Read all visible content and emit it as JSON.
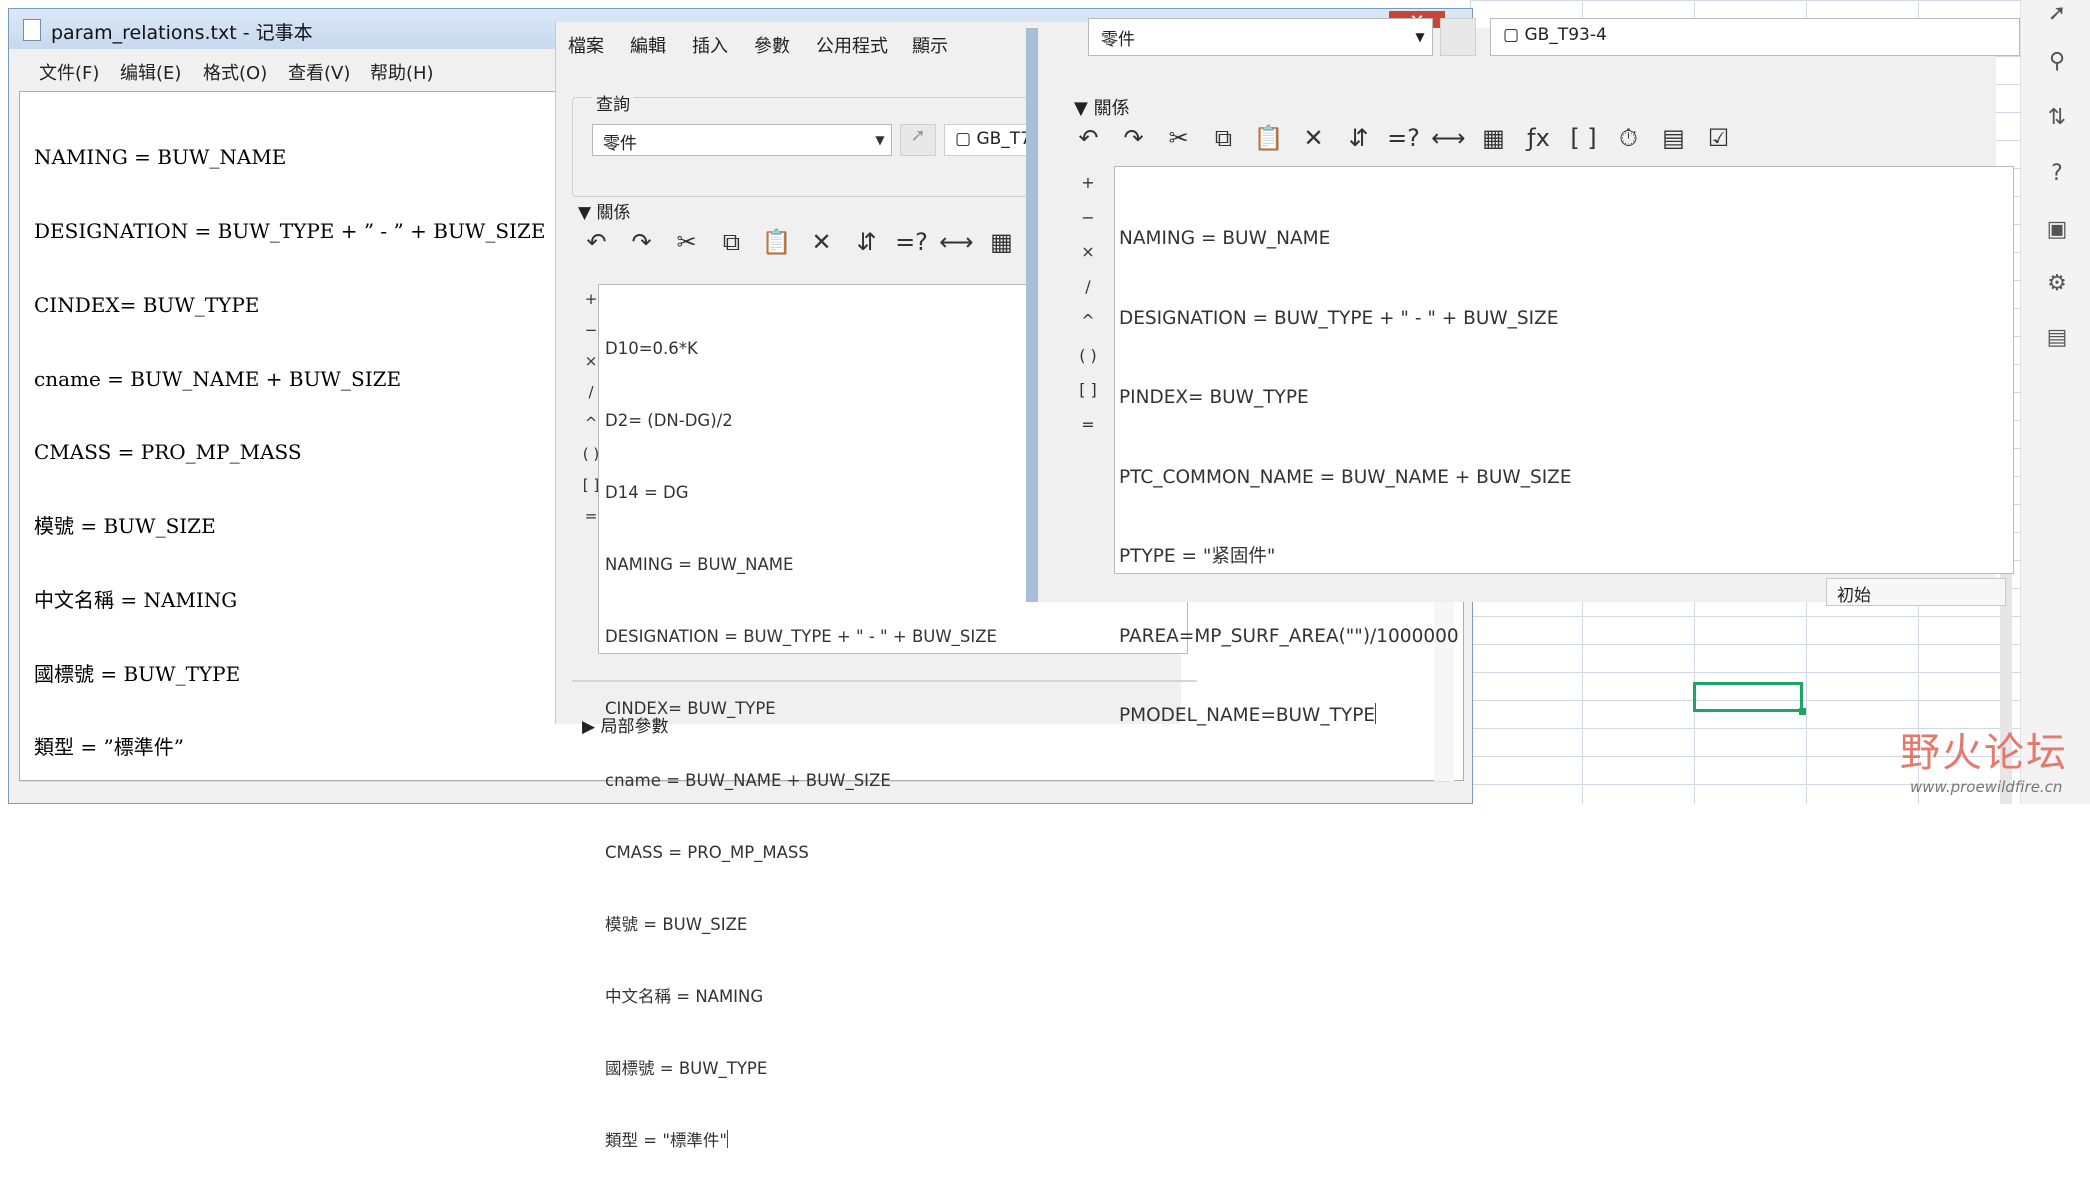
{
  "notepad": {
    "title": "param_relations.txt - 记事本",
    "close_label": "✕",
    "menu": [
      "文件(F)",
      "编辑(E)",
      "格式(O)",
      "查看(V)",
      "帮助(H)"
    ],
    "lines": [
      "NAMING = BUW_NAME",
      "DESIGNATION = BUW_TYPE + ” - ” + BUW_SIZE",
      "CINDEX= BUW_TYPE",
      "cname = BUW_NAME + BUW_SIZE",
      "CMASS = PRO_MP_MASS",
      "模號 = BUW_SIZE",
      "中文名稱 = NAMING",
      "國標號 = BUW_TYPE",
      "類型 = ”標準件”"
    ]
  },
  "dialog_left": {
    "menu": [
      "檔案",
      "編輯",
      "插入",
      "參數",
      "公用程式",
      "顯示"
    ],
    "query_title": "查詢",
    "filter_value": "零件",
    "model_value": "GB_T7",
    "relations_title": "關係",
    "ops": [
      "+",
      "−",
      "×",
      "/",
      "^",
      "( )",
      "[ ]",
      "="
    ],
    "lines": [
      "D10=0.6*K",
      "D2= (DN-DG)/2",
      "D14 = DG",
      "NAMING = BUW_NAME",
      "DESIGNATION = BUW_TYPE + \" - \" + BUW_SIZE",
      "CINDEX= BUW_TYPE",
      "cname = BUW_NAME + BUW_SIZE",
      "CMASS = PRO_MP_MASS",
      "模號 = BUW_SIZE",
      "中文名稱 = NAMING",
      "國標號 = BUW_TYPE",
      "類型 = \"標準件\""
    ],
    "local_params": "局部參數"
  },
  "dialog_right": {
    "filter_value": "零件",
    "model_value": "GB_T93-4",
    "relations_title": "關係",
    "ops": [
      "+",
      "−",
      "×",
      "/",
      "^",
      "( )",
      "[ ]",
      "="
    ],
    "lines": [
      "NAMING = BUW_NAME",
      "DESIGNATION = BUW_TYPE + \" - \" + BUW_SIZE",
      "PINDEX= BUW_TYPE",
      "PTC_COMMON_NAME = BUW_NAME + BUW_SIZE",
      "PTYPE = \"紧固件\"",
      "PAREA=MP_SURF_AREA(\"\")/1000000",
      "PMODEL_NAME=BUW_TYPE"
    ],
    "status_value": "初始"
  },
  "watermark": {
    "brand": "野火论坛",
    "url": "www.proewildfire.cn"
  }
}
